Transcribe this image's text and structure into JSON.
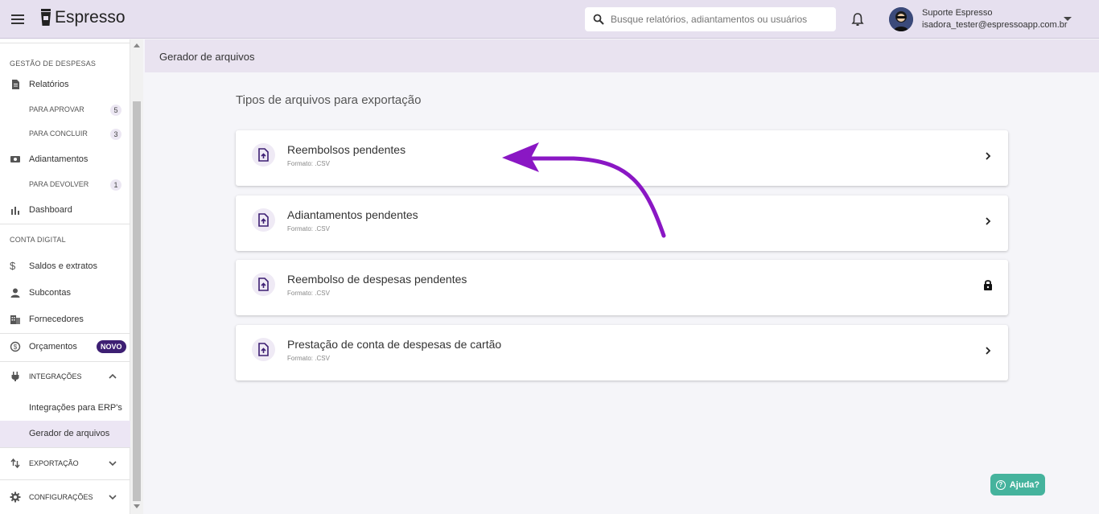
{
  "header": {
    "app_name": "Espresso",
    "search_placeholder": "Busque relatórios, adiantamentos ou usuários",
    "user_name": "Suporte Espresso",
    "user_email": "isadora_tester@espressoapp.com.br"
  },
  "sidebar": {
    "section_gestao": "GESTÃO DE DESPESAS",
    "relatorios": "Relatórios",
    "para_aprovar": "PARA APROVAR",
    "para_aprovar_count": "5",
    "para_concluir": "PARA CONCLUIR",
    "para_concluir_count": "3",
    "adiantamentos": "Adiantamentos",
    "para_devolver": "PARA DEVOLVER",
    "para_devolver_count": "1",
    "dashboard": "Dashboard",
    "section_conta": "CONTA DIGITAL",
    "saldos": "Saldos e extratos",
    "subcontas": "Subcontas",
    "fornecedores": "Fornecedores",
    "orcamentos": "Orçamentos",
    "novo_badge": "NOVO",
    "integracoes": "INTEGRAÇÕES",
    "integracoes_erp": "Integrações para ERP's",
    "gerador": "Gerador de arquivos",
    "exportacao": "EXPORTAÇÃO",
    "configuracoes": "CONFIGURAÇÕES"
  },
  "main": {
    "page_title": "Gerador de arquivos",
    "section_title": "Tipos de arquivos para exportação",
    "cards": [
      {
        "title": "Reembolsos pendentes",
        "format": "Formato: .CSV",
        "action_icon": "chevron-right-icon"
      },
      {
        "title": "Adiantamentos pendentes",
        "format": "Formato: .CSV",
        "action_icon": "chevron-right-icon"
      },
      {
        "title": "Reembolso de despesas pendentes",
        "format": "Formato: .CSV",
        "action_icon": "lock-icon"
      },
      {
        "title": "Prestação de conta de despesas de cartão",
        "format": "Formato: .CSV",
        "action_icon": "chevron-right-icon"
      }
    ]
  },
  "help_button": "Ajuda?",
  "colors": {
    "topbar_bg": "#e6e0ef",
    "accent_purple": "#3d1f73",
    "annotation_arrow": "#8a17c4",
    "help_green": "#45b39d"
  }
}
